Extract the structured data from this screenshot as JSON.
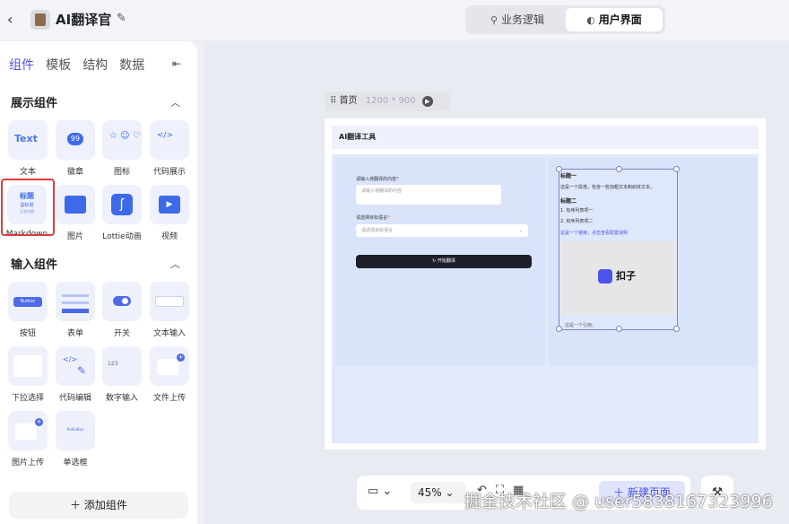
{
  "header": {
    "back_icon": "chevron-left-icon",
    "app_title": "AI翻译官",
    "edit_icon": "pencil-icon",
    "modes": [
      {
        "label": "业务逻辑",
        "icon": "flow-icon",
        "active": false
      },
      {
        "label": "用户界面",
        "icon": "palette-icon",
        "active": true
      }
    ]
  },
  "sidebar": {
    "tabs": [
      "组件",
      "模板",
      "结构",
      "数据"
    ],
    "active_tab": "组件",
    "collapse_icon": "collapse-left-icon",
    "sections": [
      {
        "title": "展示组件",
        "items": [
          "文本",
          "徽章",
          "图标",
          "代码展示",
          "Markdown",
          "图片",
          "Lottie动画",
          "视频"
        ]
      },
      {
        "title": "输入组件",
        "items": [
          "按钮",
          "表单",
          "开关",
          "文本输入",
          "下拉选择",
          "代码编辑",
          "数字输入",
          "文件上传",
          "图片上传",
          "单选框"
        ]
      }
    ],
    "selected_item": "Markdown",
    "tile_texts": {
      "text_tile": "Text",
      "badge_tile": "99",
      "markdown_tile_title": "标题",
      "markdown_tile_sub1": "副标题",
      "markdown_tile_sub2": "正文内容",
      "button_tile": "Button",
      "number_tile": "123",
      "radio_tile": "RadioBox"
    },
    "add_button": "添加组件"
  },
  "canvas": {
    "frame_name": "首页",
    "frame_size": "1200 * 900",
    "page_header": "AI翻译工具",
    "form": {
      "input_label": "请输入待翻译的内容",
      "input_placeholder": "请输入待翻译的内容",
      "lang_label": "请选择目标语言",
      "lang_placeholder": "请选择目标语言",
      "submit": "开始翻译"
    },
    "markdown": {
      "h1": "标题一",
      "p1": "这是一个段落，包含一些加粗文本和斜体文本。",
      "h2": "标题二",
      "li1": "有序列表项一",
      "li2": "有序列表项二",
      "link": "这是一个链接，点击查看配置说明",
      "image_text": "扣子",
      "quote": "这是一个引用。"
    }
  },
  "bottombar": {
    "device_icon": "desktop-icon",
    "zoom": "45%",
    "new_page": "新建页面",
    "tool_icon": "wrench-icon"
  },
  "watermark": "掘金技术社区 @ user5838167323996"
}
